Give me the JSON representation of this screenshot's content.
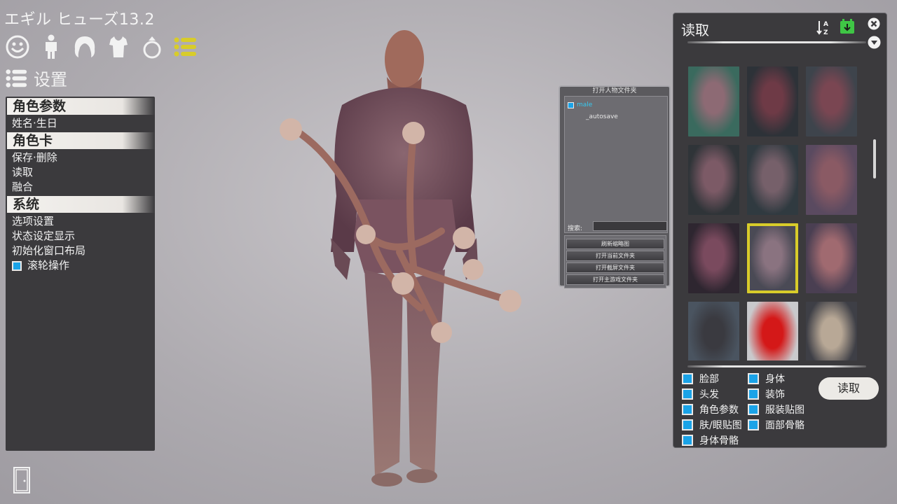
{
  "app": {
    "title": "エギル ヒューズ13.2"
  },
  "toolbar": {
    "icons": [
      "face-icon",
      "body-icon",
      "hair-icon",
      "clothes-icon",
      "accessory-icon",
      "list-icon"
    ],
    "active_color": "#d8cc2a"
  },
  "settings_header": {
    "label": "设置"
  },
  "left_menu": {
    "sections": [
      {
        "header": "角色参数",
        "items": [
          "姓名·生日"
        ]
      },
      {
        "header": "角色卡",
        "items": [
          "保存·删除",
          "读取",
          "融合"
        ]
      },
      {
        "header": "系统",
        "items": [
          "选项设置",
          "状态设定显示",
          "初始化窗口布局"
        ],
        "checkbox_item": {
          "label": "滚轮操作",
          "checked": true
        }
      }
    ]
  },
  "folder_dialog": {
    "title": "打开人物文件夹",
    "tree": {
      "root": "male",
      "child": "_autosave"
    },
    "search_label": "搜索:",
    "buttons": [
      "刷新缩略图",
      "打开当前文件夹",
      "打开截屏文件夹",
      "打开主游戏文件夹"
    ]
  },
  "read_panel": {
    "title": "读取",
    "selected_thumb_index": 7,
    "thumb_count": 12,
    "options_left": [
      {
        "label": "脸部",
        "checked": true
      },
      {
        "label": "头发",
        "checked": true
      },
      {
        "label": "角色参数",
        "checked": true
      },
      {
        "label": "肤/眼贴图",
        "checked": true
      },
      {
        "label": "身体骨骼",
        "checked": true
      }
    ],
    "options_right": [
      {
        "label": "身体",
        "checked": true
      },
      {
        "label": "装饰",
        "checked": true
      },
      {
        "label": "服装贴图",
        "checked": true
      },
      {
        "label": "面部骨骼",
        "checked": true
      }
    ],
    "read_button": "读取",
    "checkbox_color": "#1aa3e8"
  }
}
